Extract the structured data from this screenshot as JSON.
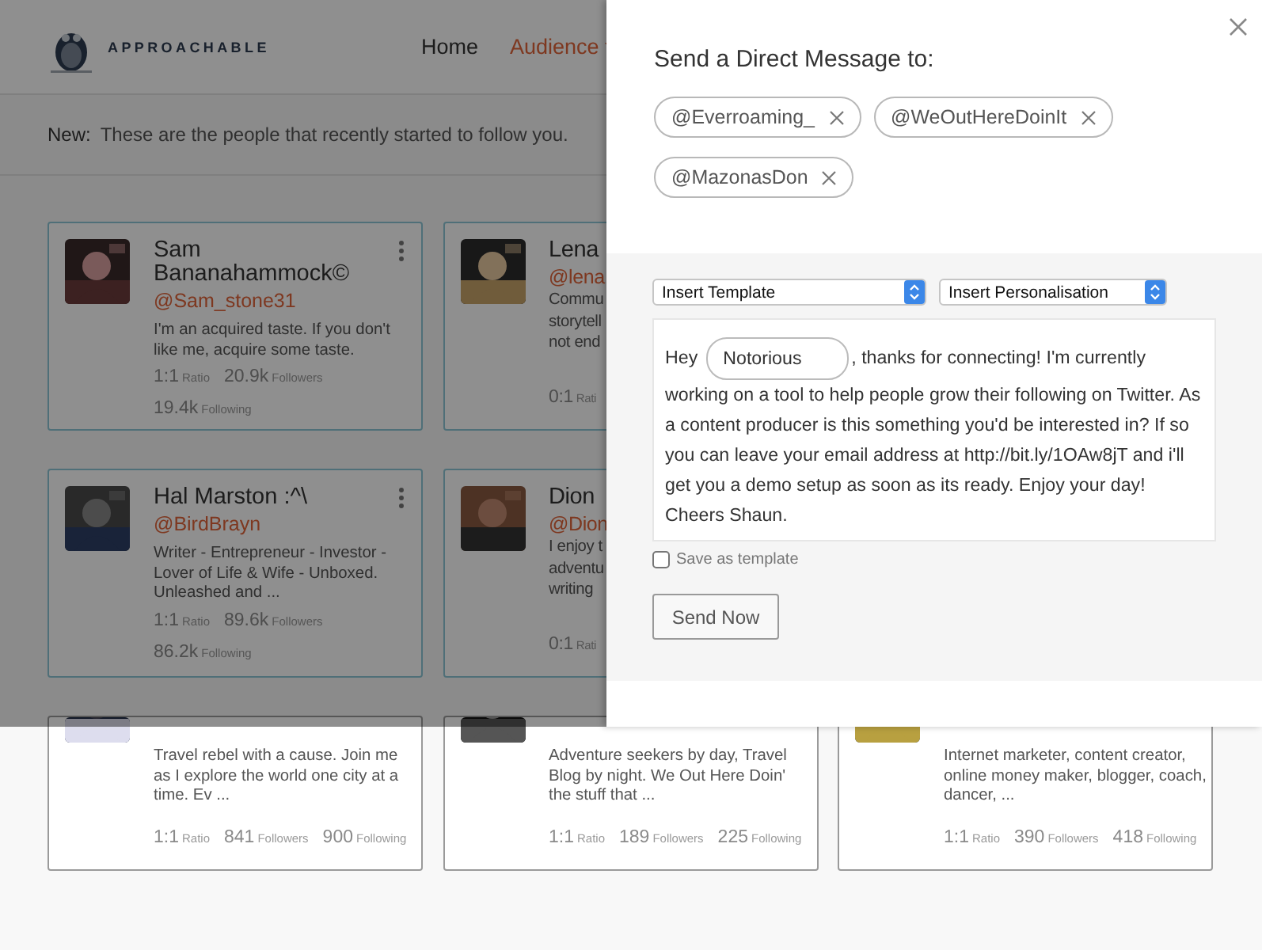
{
  "header": {
    "brand": "APPROACHABLE",
    "nav": [
      {
        "label": "Home",
        "selected": false,
        "dropdown": false
      },
      {
        "label": "Audience",
        "selected": true,
        "dropdown": true
      }
    ]
  },
  "notice": {
    "label": "New:",
    "text": "These are the people that recently started to follow you."
  },
  "card_rows": [
    [
      {
        "kind": "full",
        "highlighted": true,
        "name": "Sam Bananahammock©",
        "handle": "@Sam_stone31",
        "bio": "I'm an acquired taste. If you don't like me, acquire some taste.",
        "stats": [
          {
            "number": "1:1",
            "unit": "Ratio"
          },
          {
            "number": "20.9k",
            "unit": "Followers"
          },
          {
            "number": "19.4k",
            "unit": "Following"
          }
        ]
      },
      {
        "kind": "clipped",
        "highlighted": true,
        "name": "Lena",
        "handle": "@lena",
        "bio": "Commu\nstorytell\nnot end",
        "stats": [
          {
            "number": "0:1",
            "unit": "Rati"
          }
        ]
      }
    ],
    [
      {
        "kind": "full",
        "highlighted": true,
        "name": "Hal Marston :^\\",
        "handle": "@BirdBrayn",
        "bio": "Writer - Entrepreneur - Investor - Lover of Life & Wife - Unboxed. Unleashed and ...",
        "stats": [
          {
            "number": "1:1",
            "unit": "Ratio"
          },
          {
            "number": "89.6k",
            "unit": "Followers"
          },
          {
            "number": "86.2k",
            "unit": "Following"
          }
        ]
      },
      {
        "kind": "clipped",
        "highlighted": true,
        "name": "Dion",
        "handle": "@Dion",
        "bio": "I enjoy t\nadventu\nwriting",
        "stats": [
          {
            "number": "0:1",
            "unit": "Rati"
          }
        ]
      }
    ],
    [
      {
        "kind": "lower",
        "highlighted": false,
        "bio": "Travel rebel with a cause. Join me as I explore the world one city at a time. Ev ...",
        "stats": [
          {
            "number": "1:1",
            "unit": "Ratio"
          },
          {
            "number": "841",
            "unit": "Followers"
          },
          {
            "number": "900",
            "unit": "Following"
          }
        ]
      },
      {
        "kind": "lower",
        "highlighted": false,
        "bio": "Adventure seekers by day, Travel Blog by night. We Out Here Doin' the stuff that ...",
        "stats": [
          {
            "number": "1:1",
            "unit": "Ratio"
          },
          {
            "number": "189",
            "unit": "Followers"
          },
          {
            "number": "225",
            "unit": "Following"
          }
        ]
      },
      {
        "kind": "lower",
        "highlighted": false,
        "bio": "Internet marketer, content creator, online money maker, blogger, coach, dancer, ...",
        "stats": [
          {
            "number": "1:1",
            "unit": "Ratio"
          },
          {
            "number": "390",
            "unit": "Followers"
          },
          {
            "number": "418",
            "unit": "Following"
          }
        ]
      }
    ]
  ],
  "dm_modal": {
    "title": "Send a Direct Message to:",
    "recipients": [
      "@Everroaming_",
      "@WeOutHereDoinIt",
      "@MazonasDon"
    ],
    "template_select": "Insert Template",
    "personalisation_select": "Insert Personalisation",
    "message": {
      "greeting": "Hey",
      "name_value": "Notorious",
      "body": ", thanks for connecting! I'm currently working on a tool to help people grow their following on Twitter. As a content producer is this something you'd be interested in? If so you can leave your email address at http://bit.ly/1OAw8jT and i'll get you a demo setup as soon as its ready. Enjoy your day! Cheers Shaun."
    },
    "save_as_template": {
      "label": "Save as template",
      "checked": false
    },
    "send_button": "Send Now"
  }
}
